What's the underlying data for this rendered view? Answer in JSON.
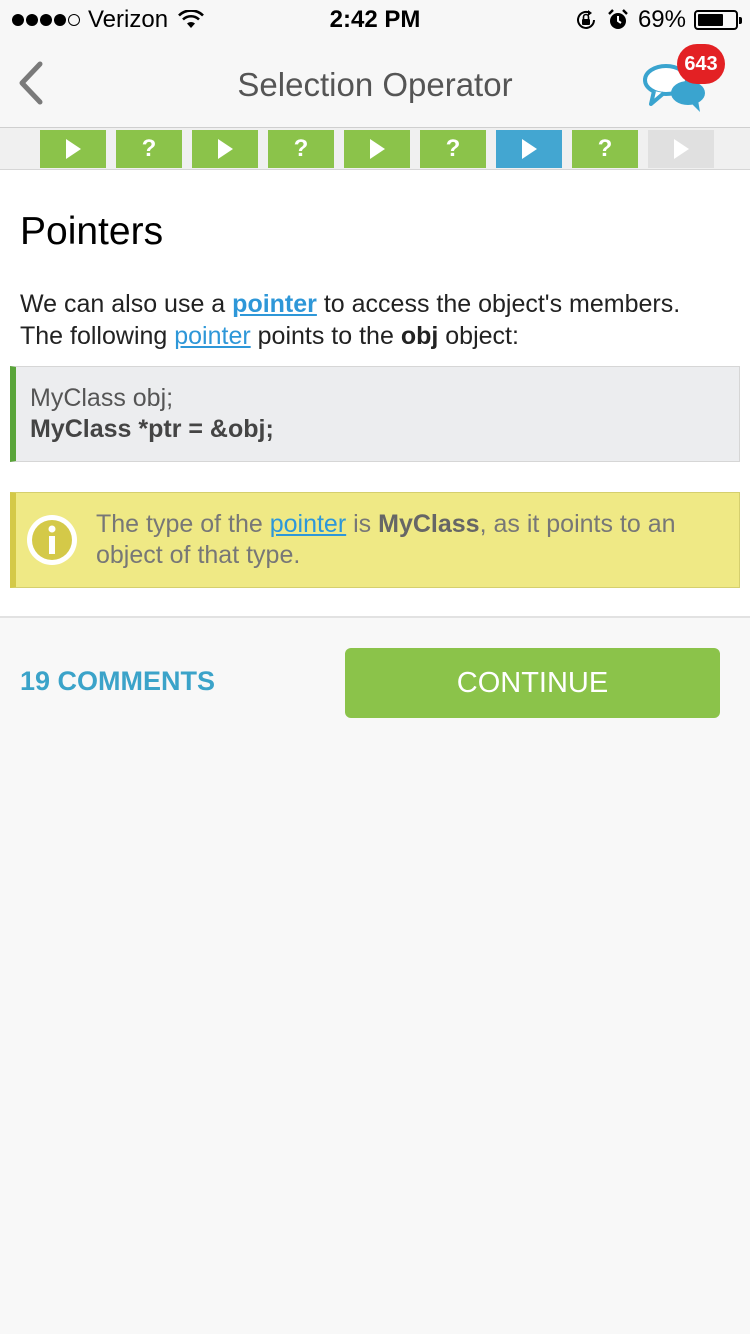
{
  "status_bar": {
    "carrier": "Verizon",
    "time": "2:42 PM",
    "battery": "69%",
    "battery_level": 0.69
  },
  "nav": {
    "title": "Selection Operator",
    "notification_count": "643",
    "back_icon": "chevron-left-icon",
    "chat_icon": "chat-bubbles-icon"
  },
  "progress_steps": [
    {
      "type": "play",
      "state": "done"
    },
    {
      "type": "quiz",
      "label": "?",
      "state": "done"
    },
    {
      "type": "play",
      "state": "done"
    },
    {
      "type": "quiz",
      "label": "?",
      "state": "done"
    },
    {
      "type": "play",
      "state": "done"
    },
    {
      "type": "quiz",
      "label": "?",
      "state": "done"
    },
    {
      "type": "play",
      "state": "current"
    },
    {
      "type": "quiz",
      "label": "?",
      "state": "done"
    },
    {
      "type": "play",
      "state": "locked"
    }
  ],
  "lesson": {
    "title": "Pointers",
    "para": {
      "t1": "We can also use a ",
      "link1": "pointer",
      "t2": " to access the object's members.",
      "t3": "The following ",
      "link2": "pointer",
      "t4": " points to the ",
      "bold": "obj",
      "t5": " object:"
    },
    "code": {
      "line1": "MyClass obj;",
      "line2": "MyClass *ptr = &obj;"
    },
    "note": {
      "t1": "The type of the ",
      "link": "pointer",
      "t2": " is ",
      "bold": "MyClass",
      "t3": ", as it points to an object of that type."
    }
  },
  "footer": {
    "comments_label": "19 COMMENTS",
    "continue_label": "CONTINUE"
  },
  "colors": {
    "green": "#8bc34a",
    "blue": "#43a6d1",
    "link": "#2e97d8",
    "badge": "#e32124",
    "note_bg": "#efe985"
  }
}
